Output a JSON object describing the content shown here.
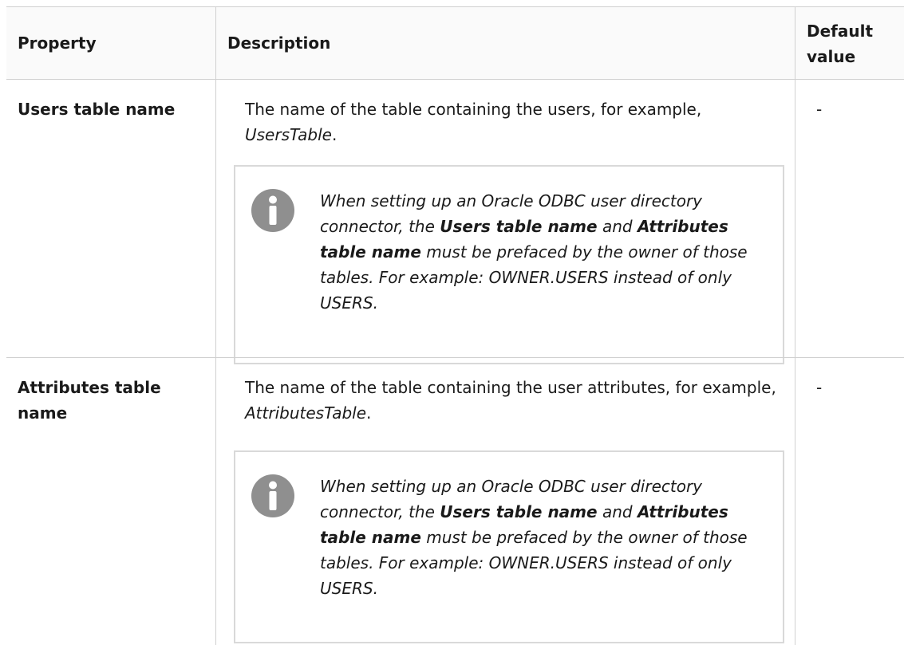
{
  "header": {
    "property": "Property",
    "description": "Description",
    "default_value": "Default value"
  },
  "rows": [
    {
      "property": "Users table name",
      "desc_prefix": "The name of the table containing the users, for example,",
      "desc_example": "UsersTable",
      "desc_suffix": ".",
      "default": "-",
      "note": {
        "icon": "info-icon",
        "part1": "When setting up an Oracle ODBC user directory connector, the",
        "bold1": "Users table name",
        "part2": "and",
        "bold2": "Attributes table name",
        "part3": "must be prefaced by the owner of those tables. For example: OWNER.USERS instead of only USERS."
      }
    },
    {
      "property": "Attributes table name",
      "desc_prefix": "The name of the table containing the user attributes, for example,",
      "desc_example": "AttributesTable",
      "desc_suffix": ".",
      "default": "-",
      "note": {
        "icon": "info-icon",
        "part1": "When setting up an Oracle ODBC user directory connector, the",
        "bold1": "Users table name",
        "part2": "and",
        "bold2": "Attributes table name",
        "part3": "must be prefaced by the owner of those tables. For example: OWNER.USERS instead of only USERS."
      }
    }
  ],
  "colors": {
    "border": "#d0d0d0",
    "note_border": "#d9d9d9",
    "icon": "#8f8f8f",
    "text": "#1a1a1a"
  }
}
